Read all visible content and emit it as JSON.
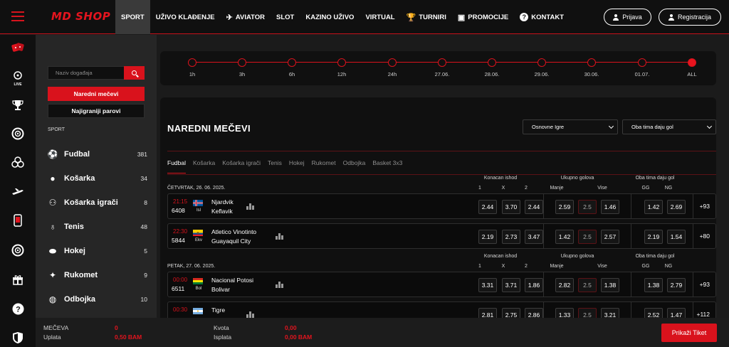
{
  "brand": {
    "logo_text": "MD SHOP",
    "accent_color": "#d9121c"
  },
  "nav": {
    "items": [
      {
        "label": "SPORT",
        "icon": "",
        "active": true
      },
      {
        "label": "UŽIVO KLAĐENJE",
        "icon": ""
      },
      {
        "label": "AVIATOR",
        "icon": "plane-icon"
      },
      {
        "label": "SLOT",
        "icon": ""
      },
      {
        "label": "KAZINO UŽIVO",
        "icon": ""
      },
      {
        "label": "VIRTUAL",
        "icon": ""
      },
      {
        "label": "TURNIRI",
        "icon": "trophy-icon"
      },
      {
        "label": "PROMOCIJE",
        "icon": "gift-icon"
      },
      {
        "label": "KONTAKT",
        "icon": "question-icon"
      }
    ],
    "login_label": "Prijava",
    "register_label": "Registracija"
  },
  "rail": {
    "icons": [
      "dice-icon",
      "live-casino-icon",
      "trophy-icon",
      "roulette-icon",
      "chips-icon",
      "plane-icon",
      "mobile-icon",
      "roulette-icon",
      "gift-icon",
      "help-icon",
      "shield-icon"
    ],
    "live_label": "LIVE"
  },
  "sidebar": {
    "search_placeholder": "Naziv događaja",
    "upcoming_button": "Naredni mečevi",
    "most_played_button": "Najigraniji parovi",
    "section_label": "SPORT",
    "sports": [
      {
        "name": "Fudbal",
        "count": "381",
        "icon": "football-icon"
      },
      {
        "name": "Košarka",
        "count": "34",
        "icon": "basketball-icon"
      },
      {
        "name": "Košarka igrači",
        "count": "8",
        "icon": "basketball-players-icon"
      },
      {
        "name": "Tenis",
        "count": "48",
        "icon": "tennis-icon"
      },
      {
        "name": "Hokej",
        "count": "5",
        "icon": "hockey-icon"
      },
      {
        "name": "Rukomet",
        "count": "9",
        "icon": "handball-icon"
      },
      {
        "name": "Odbojka",
        "count": "10",
        "icon": "volleyball-icon"
      }
    ]
  },
  "timeline": {
    "points": [
      "1h",
      "3h",
      "6h",
      "12h",
      "24h",
      "27.06.",
      "28.06.",
      "29.06.",
      "30.06.",
      "01.07.",
      "ALL"
    ],
    "active_index": 10
  },
  "matches_panel": {
    "title": "NAREDNI MEČEVI",
    "market_select": "Osnovne Igre",
    "secondary_select": "Oba tima daju gol",
    "tabs": [
      "Fudbal",
      "Košarka",
      "Košarka igrači",
      "Tenis",
      "Hokej",
      "Rukomet",
      "Odbojka",
      "Basket 3x3"
    ],
    "active_tab": 0,
    "market_headers": {
      "result": "Konacan ishod",
      "total": "Ukupno golova",
      "btts": "Oba tima daju gol"
    },
    "sub_headers": {
      "result": [
        "1",
        "X",
        "2"
      ],
      "total": [
        "Manje",
        "",
        "Vise"
      ],
      "btts": [
        "GG",
        "NG"
      ]
    },
    "groups": [
      {
        "date": "ČETVRTAK, 26. 06. 2025.",
        "matches": [
          {
            "time": "21:15",
            "code": "6408",
            "country": "Isl",
            "flag": "isl",
            "home": "Njardvik",
            "away": "Keflavik",
            "odds_result": [
              "2.44",
              "3.70",
              "2.44"
            ],
            "odds_total": [
              "2.59",
              "2.5",
              "1.46"
            ],
            "odds_btts": [
              "1.42",
              "2.69"
            ],
            "more": "+93"
          },
          {
            "time": "22:30",
            "code": "5844",
            "country": "Ekv",
            "flag": "ekv",
            "home": "Atletico Vinotinto",
            "away": "Guayaquil City",
            "odds_result": [
              "2.19",
              "2.73",
              "3.47"
            ],
            "odds_total": [
              "1.42",
              "2.5",
              "2.57"
            ],
            "odds_btts": [
              "2.19",
              "1.54"
            ],
            "more": "+80"
          }
        ]
      },
      {
        "date": "PETAK, 27. 06. 2025.",
        "matches": [
          {
            "time": "00:00",
            "code": "6511",
            "country": "Bol",
            "flag": "bol",
            "home": "Nacional Potosi",
            "away": "Bolivar",
            "odds_result": [
              "3.31",
              "3.71",
              "1.86"
            ],
            "odds_total": [
              "2.82",
              "2.5",
              "1.38"
            ],
            "odds_btts": [
              "1.38",
              "2.79"
            ],
            "more": "+93"
          },
          {
            "time": "00:30",
            "code": "",
            "country": "",
            "flag": "arg",
            "home": "Tigre",
            "away": "",
            "odds_result": [
              "2.81",
              "2.75",
              "2.86"
            ],
            "odds_total": [
              "1.33",
              "2.5",
              "3.21"
            ],
            "odds_btts": [
              "2.52",
              "1.47"
            ],
            "more": "+112"
          }
        ]
      }
    ]
  },
  "ticket": {
    "matches_label": "MEČEVA",
    "matches_value": "0",
    "payment_label": "Uplata",
    "payment_value": "0,50 BAM",
    "odds_label": "Kvota",
    "odds_value": "0,00",
    "payout_label": "Isplata",
    "payout_value": "0,00 BAM",
    "show_button": "Prikaži Tiket"
  }
}
